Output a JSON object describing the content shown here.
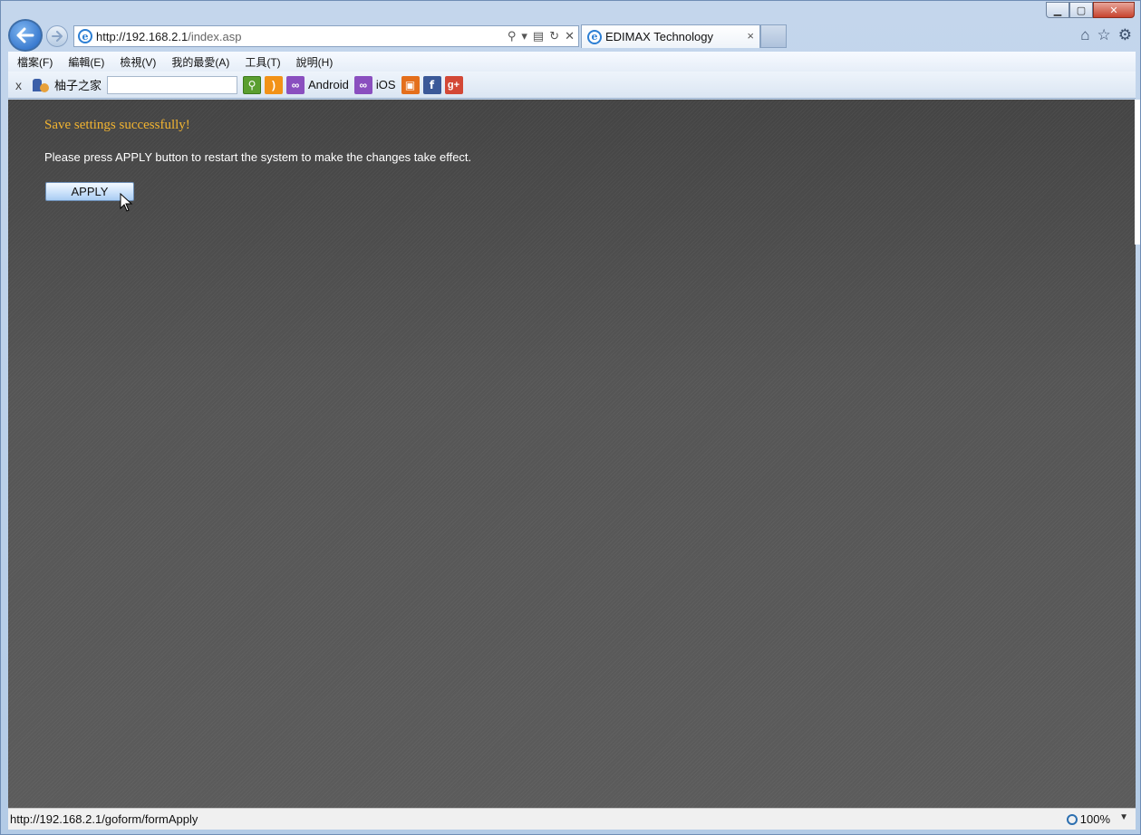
{
  "browser": {
    "url_host": "http://192.168.2.1",
    "url_path": "/index.asp",
    "tab_title": "EDIMAX Technology",
    "tab_close": "×",
    "back_glyph": "🡐",
    "forward_glyph": "→",
    "caption_min": "▁",
    "caption_max": "▢",
    "caption_close": "✕",
    "icons": [
      "home-icon",
      "star-icon",
      "gear-icon"
    ]
  },
  "menu": {
    "items": [
      "檔案(F)",
      "編輯(E)",
      "檢視(V)",
      "我的最愛(A)",
      "工具(T)",
      "說明(H)"
    ]
  },
  "toolbar": {
    "close": "x",
    "site_label": "柚子之家",
    "android_label": "Android",
    "ios_label": "iOS"
  },
  "page": {
    "success_message": "Save settings successfully!",
    "instruction": "Please press APPLY button to restart the system to make the changes take effect.",
    "apply_label": "APPLY"
  },
  "status": {
    "url": "http://192.168.2.1/goform/formApply",
    "zoom": "100%"
  },
  "colors": {
    "success": "#f2b431",
    "content_bg": "#4f4f4f"
  }
}
